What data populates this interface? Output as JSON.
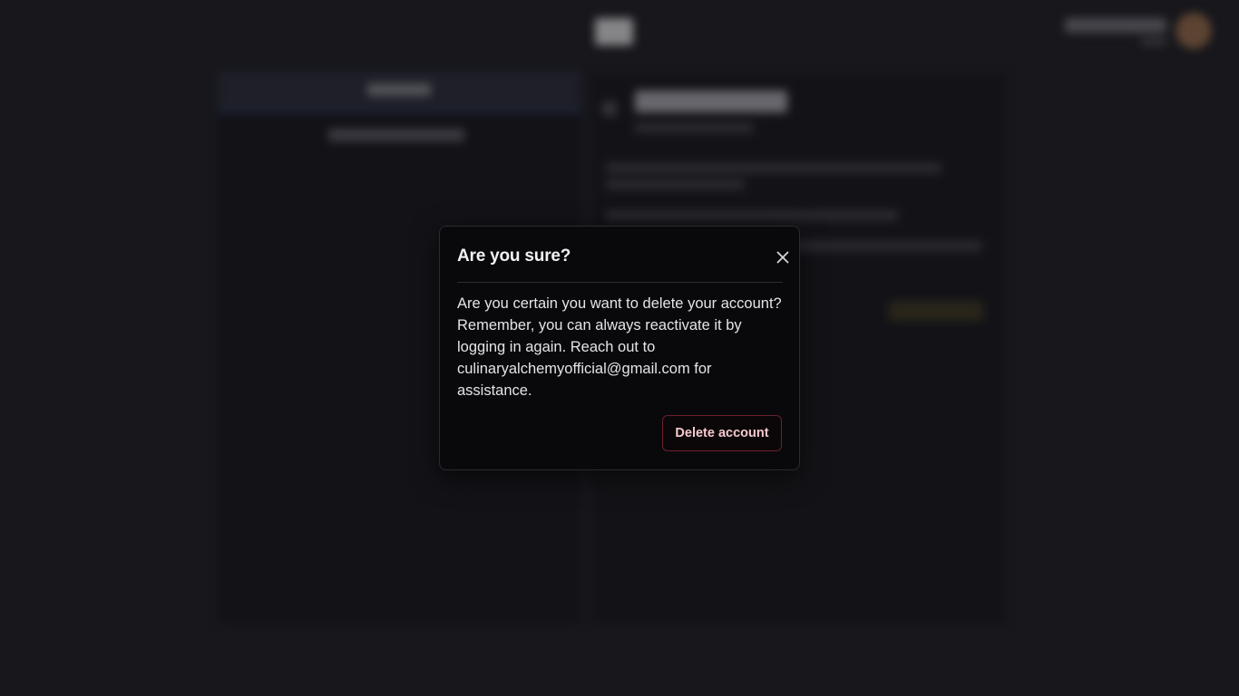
{
  "modal": {
    "title": "Are you sure?",
    "close_icon": "close-icon",
    "message": "Are you certain you want to delete your account? Remember, you can always reactivate it by logging in again. Reach out to culinaryalchemyofficial@gmail.com for assistance.",
    "delete_button_label": "Delete account"
  },
  "colors": {
    "page_background": "#1f1f24",
    "modal_background": "#09090c",
    "danger_border": "#6b1f2e",
    "danger_text": "#f4c9cf"
  }
}
